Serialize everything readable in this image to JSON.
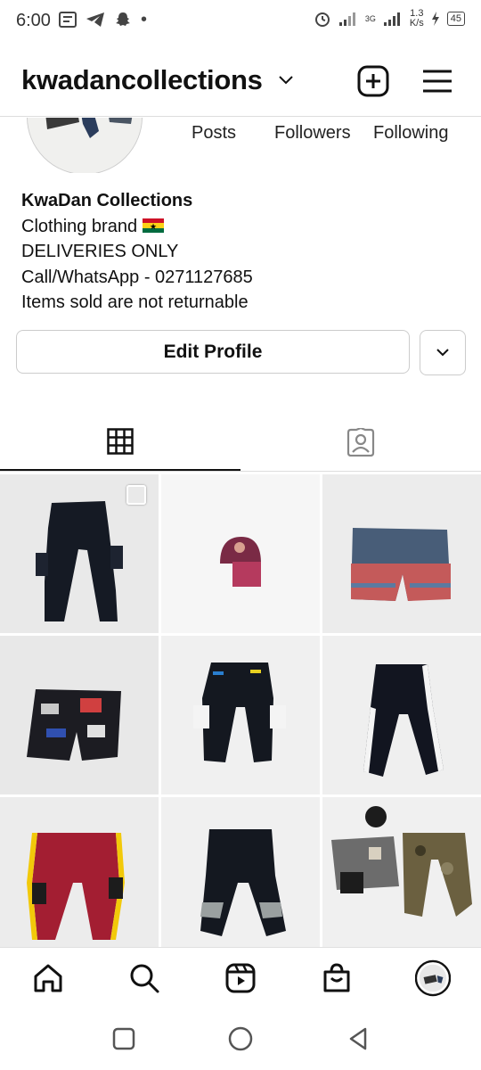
{
  "status_bar": {
    "time": "6:00",
    "network_speed": "1.3",
    "network_unit": "K/s",
    "signal_label": "3G",
    "battery": "45"
  },
  "header": {
    "username": "kwadancollections"
  },
  "stats": {
    "posts_label": "Posts",
    "followers_label": "Followers",
    "following_label": "Following"
  },
  "bio": {
    "name": "KwaDan Collections",
    "line1": "Clothing brand",
    "line2": "DELIVERIES ONLY",
    "line3": "Call/WhatsApp - 0271127685",
    "line4": "Items sold are not returnable"
  },
  "buttons": {
    "edit_profile": "Edit Profile"
  },
  "posts": [
    {
      "name": "post-black-cargo-joggers"
    },
    {
      "name": "post-pink-cap"
    },
    {
      "name": "post-striped-shorts"
    },
    {
      "name": "post-graffiti-shorts"
    },
    {
      "name": "post-black-joggers-colorblock"
    },
    {
      "name": "post-black-joggers-white-stripe"
    },
    {
      "name": "post-red-joggers"
    },
    {
      "name": "post-black-joggers-camo"
    },
    {
      "name": "post-outfit-set"
    }
  ],
  "icons": {
    "add": "plus-square-icon",
    "menu": "hamburger-menu-icon",
    "grid": "grid-icon",
    "tagged": "tagged-icon",
    "home": "home-icon",
    "search": "search-icon",
    "reels": "reels-icon",
    "shop": "shop-icon",
    "profile": "profile-avatar-icon"
  },
  "colors": {
    "text": "#111111",
    "border": "#cccccc",
    "background": "#ffffff"
  }
}
